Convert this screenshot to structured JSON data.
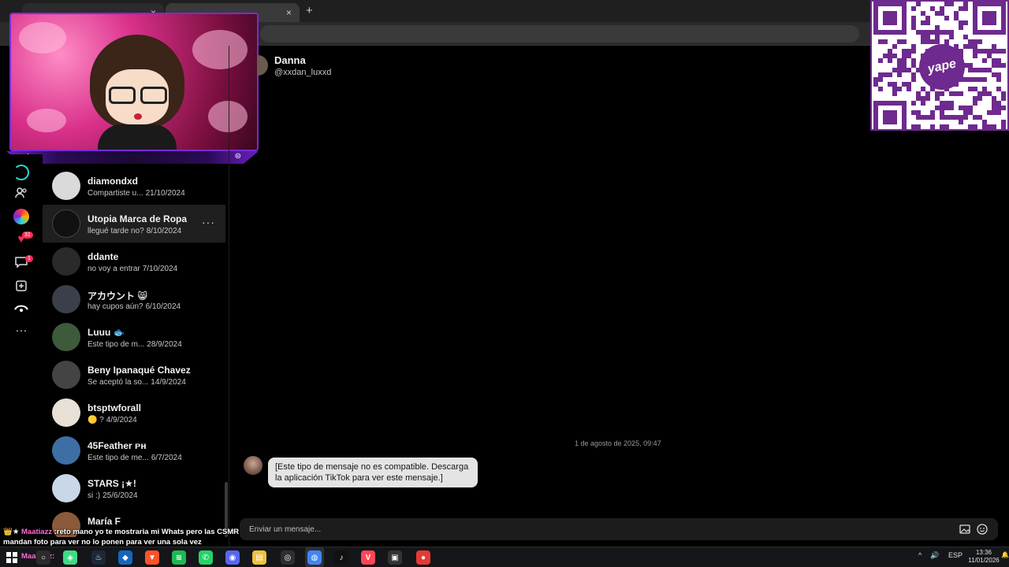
{
  "browser": {
    "tabs": [
      {
        "label": "",
        "close": "×"
      },
      {
        "label": "",
        "close": "×"
      }
    ],
    "new_tab": "+"
  },
  "overlay": {
    "star_symbol": "★",
    "badge_symbol": "⊜"
  },
  "qr": {
    "brand": "yape",
    "color": "#6e2a8e"
  },
  "rail": {
    "icons": [
      "circle-refresh-icon",
      "people-icon",
      "colorful-ball-icon",
      "heart-gift-icon",
      "inbox-icon",
      "add-icon",
      "profile-icon",
      "more-icon"
    ],
    "badges": {
      "gift": "31",
      "inbox": "1"
    }
  },
  "conversations": [
    {
      "name": "diamondxd",
      "preview": "Compartiste u...",
      "date": "21/10/2024"
    },
    {
      "name": "Utopia Marca de Ropa",
      "preview": "llegué tarde no?",
      "date": "8/10/2024",
      "active": true,
      "more": "···"
    },
    {
      "name": "ddante",
      "preview": "no voy a entrar",
      "date": "7/10/2024"
    },
    {
      "name": "アカウント 😸",
      "preview": "hay cupos aún?",
      "date": "6/10/2024"
    },
    {
      "name": "Luuu 🐟",
      "preview": "Este tipo de m...",
      "date": "28/9/2024"
    },
    {
      "name": "Beny Ipanaqué Chavez",
      "preview": "Se aceptó la so...",
      "date": "14/9/2024"
    },
    {
      "name": "btsptwforall",
      "preview": "🟡 ?",
      "date": "4/9/2024"
    },
    {
      "name": "45Feather ᴘʜ",
      "preview": "Este tipo de me...",
      "date": "6/7/2024"
    },
    {
      "name": "STARS ¡★!",
      "preview": "si :)",
      "date": "25/6/2024"
    },
    {
      "name": "María F",
      "preview": "",
      "date": ""
    }
  ],
  "chat": {
    "name": "Danna",
    "handle": "@xxdan_luxxd",
    "messages": [
      {
        "timestamp": "1 de agosto de 2025, 09:47",
        "text": "[Este tipo de mensaje no es compatible. Descarga la aplicación TikTok para ver este mensaje.]"
      }
    ],
    "composer_placeholder": "Enviar un mensaje..."
  },
  "stream_chat": {
    "user": "Maatiazz",
    "text": " :reto mano yo te mostraria mi Whats pero las CSMR mandan foto para ver no lo ponen para ver una sola vez",
    "user2": "Maatiazz:"
  },
  "taskbar": {
    "apps": [
      {
        "icon": "search-icon",
        "color": "#2b2b2b",
        "glyph": "○"
      },
      {
        "icon": "android-icon",
        "color": "#3ddc84",
        "glyph": "◈"
      },
      {
        "icon": "steam-icon",
        "color": "#1b2838",
        "glyph": "♨"
      },
      {
        "icon": "app-icon",
        "color": "#1565c0",
        "glyph": "◆"
      },
      {
        "icon": "brave-icon",
        "color": "#fb542b",
        "glyph": "▼"
      },
      {
        "icon": "spotify-icon",
        "color": "#1db954",
        "glyph": "≋"
      },
      {
        "icon": "whatsapp-icon",
        "color": "#25d366",
        "glyph": "✆"
      },
      {
        "icon": "discord-icon",
        "color": "#5865f2",
        "glyph": "◉"
      },
      {
        "icon": "files-icon",
        "color": "#f0c23c",
        "glyph": "▤"
      },
      {
        "icon": "obs-icon",
        "color": "#302e31",
        "glyph": "◎"
      },
      {
        "icon": "chrome-icon",
        "color": "#4285f4",
        "glyph": "◍"
      },
      {
        "icon": "tiktok-icon",
        "color": "#111111",
        "glyph": "♪"
      },
      {
        "icon": "valorant-icon",
        "color": "#ff4655",
        "glyph": "V"
      },
      {
        "icon": "media-icon",
        "color": "#333333",
        "glyph": "▣"
      },
      {
        "icon": "red-app-icon",
        "color": "#e53935",
        "glyph": "●"
      }
    ],
    "tray": {
      "chevron": "^",
      "volume": "🔊",
      "lang": "ESP",
      "bell": "🔔"
    },
    "time": "13:36",
    "date": "11/01/2026"
  }
}
